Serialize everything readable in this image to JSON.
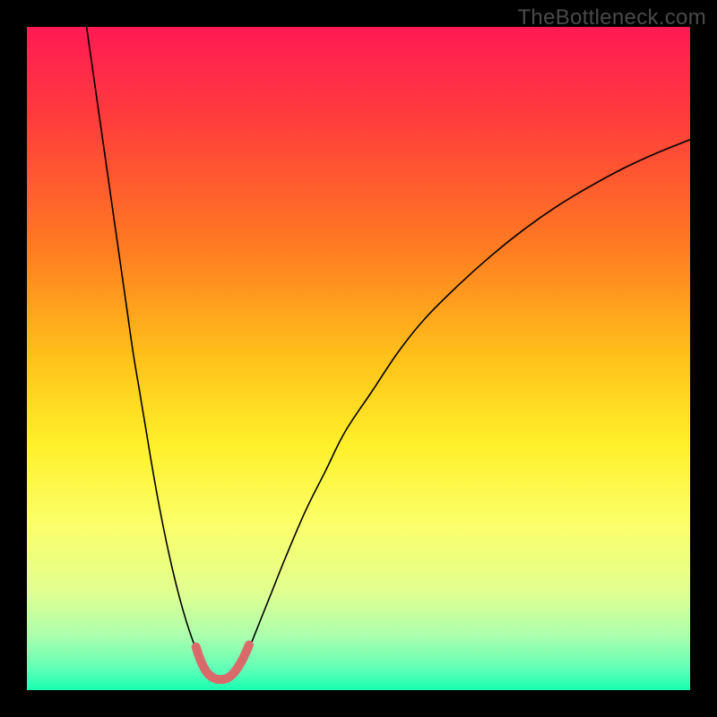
{
  "watermark": "TheBottleneck.com",
  "chart_data": {
    "type": "line",
    "title": "",
    "xlabel": "",
    "ylabel": "",
    "xlim": [
      0,
      100
    ],
    "ylim": [
      0,
      100
    ],
    "grid": false,
    "background_gradient": {
      "stops": [
        {
          "offset": 0.0,
          "color": "#ff1a54"
        },
        {
          "offset": 0.14,
          "color": "#ff3d3c"
        },
        {
          "offset": 0.33,
          "color": "#ff7a22"
        },
        {
          "offset": 0.5,
          "color": "#ffc21a"
        },
        {
          "offset": 0.63,
          "color": "#fff02a"
        },
        {
          "offset": 0.75,
          "color": "#fbff6a"
        },
        {
          "offset": 0.85,
          "color": "#e2ff8f"
        },
        {
          "offset": 0.92,
          "color": "#aaffae"
        },
        {
          "offset": 0.97,
          "color": "#5cffb8"
        },
        {
          "offset": 1.0,
          "color": "#18ffb0"
        }
      ]
    },
    "series": [
      {
        "name": "curve-left",
        "stroke": "#000000",
        "stroke_width": 1.6,
        "x": [
          9,
          10,
          11,
          12,
          13,
          14,
          15,
          16,
          17,
          18,
          19,
          20,
          21,
          22,
          23,
          24,
          25,
          26
        ],
        "values": [
          100,
          93,
          86,
          79,
          72,
          65,
          58,
          51,
          45,
          39,
          33,
          27.5,
          22.5,
          18,
          14,
          10.5,
          7.5,
          5
        ]
      },
      {
        "name": "curve-right",
        "stroke": "#000000",
        "stroke_width": 1.6,
        "x": [
          33,
          35,
          37,
          39,
          42,
          45,
          48,
          52,
          56,
          60,
          65,
          70,
          75,
          80,
          85,
          90,
          95,
          100
        ],
        "values": [
          5,
          10,
          15,
          20,
          27,
          33,
          39,
          45,
          51,
          56,
          61,
          65.5,
          69.5,
          73,
          76,
          78.7,
          81,
          83
        ]
      },
      {
        "name": "valley-highlight",
        "stroke": "#d96a6a",
        "stroke_width": 10,
        "linecap": "round",
        "x": [
          25.5,
          26.3,
          27.2,
          28.2,
          29.2,
          30.2,
          31.2,
          32.4,
          33.5
        ],
        "values": [
          6.5,
          4.2,
          2.6,
          1.8,
          1.6,
          1.8,
          2.6,
          4.4,
          6.8
        ]
      }
    ]
  }
}
